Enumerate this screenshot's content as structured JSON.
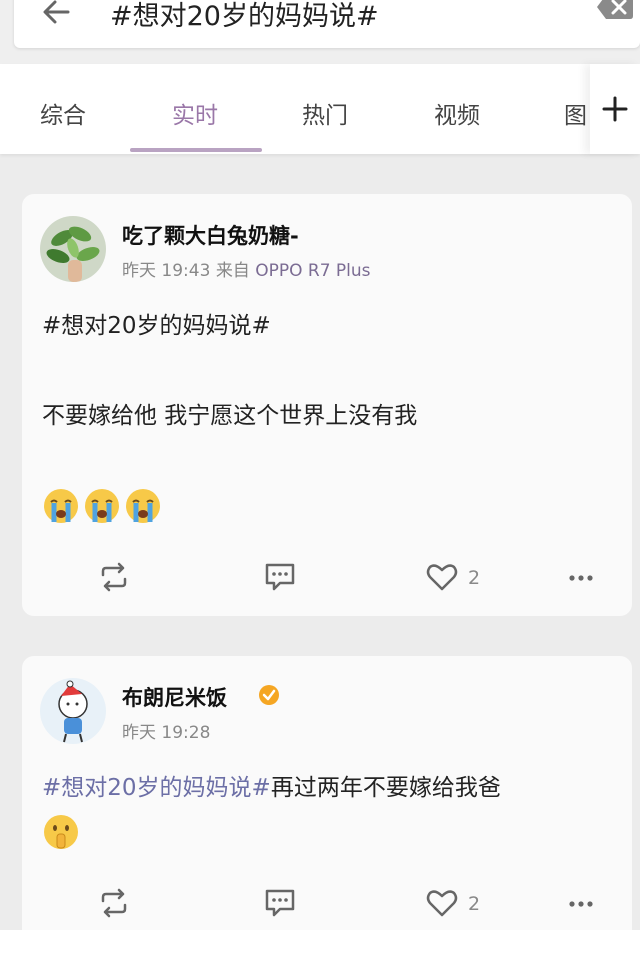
{
  "search": {
    "query": "#想对20岁的妈妈说#",
    "back_icon": "back-arrow-icon",
    "clear_icon": "clear-icon"
  },
  "tabs": [
    {
      "label": "综合",
      "active": false
    },
    {
      "label": "实时",
      "active": true
    },
    {
      "label": "热门",
      "active": false
    },
    {
      "label": "视频",
      "active": false
    },
    {
      "label": "图",
      "active": false
    }
  ],
  "add_tab_icon": "plus-icon",
  "colors": {
    "accent": "#9a77a8",
    "hashtag": "#6c6fa6",
    "verified": "#f5a623"
  },
  "posts": [
    {
      "username": "吃了颗大白兔奶糖-",
      "time": "昨天 19:43",
      "source_prefix": "来自",
      "source": "OPPO R7 Plus",
      "hashtag": "#想对20岁的妈妈说#",
      "body": "不要嫁给他 我宁愿这个世界上没有我",
      "emojis": [
        "crying-face",
        "crying-face",
        "crying-face"
      ],
      "likes": "2",
      "verified": false
    },
    {
      "username": "布朗尼米饭",
      "time": "昨天 19:28",
      "hashtag": "#想对20岁的妈妈说#",
      "body": "再过两年不要嫁给我爸",
      "emojis": [
        "shushing-face"
      ],
      "likes": "2",
      "verified": true
    }
  ]
}
